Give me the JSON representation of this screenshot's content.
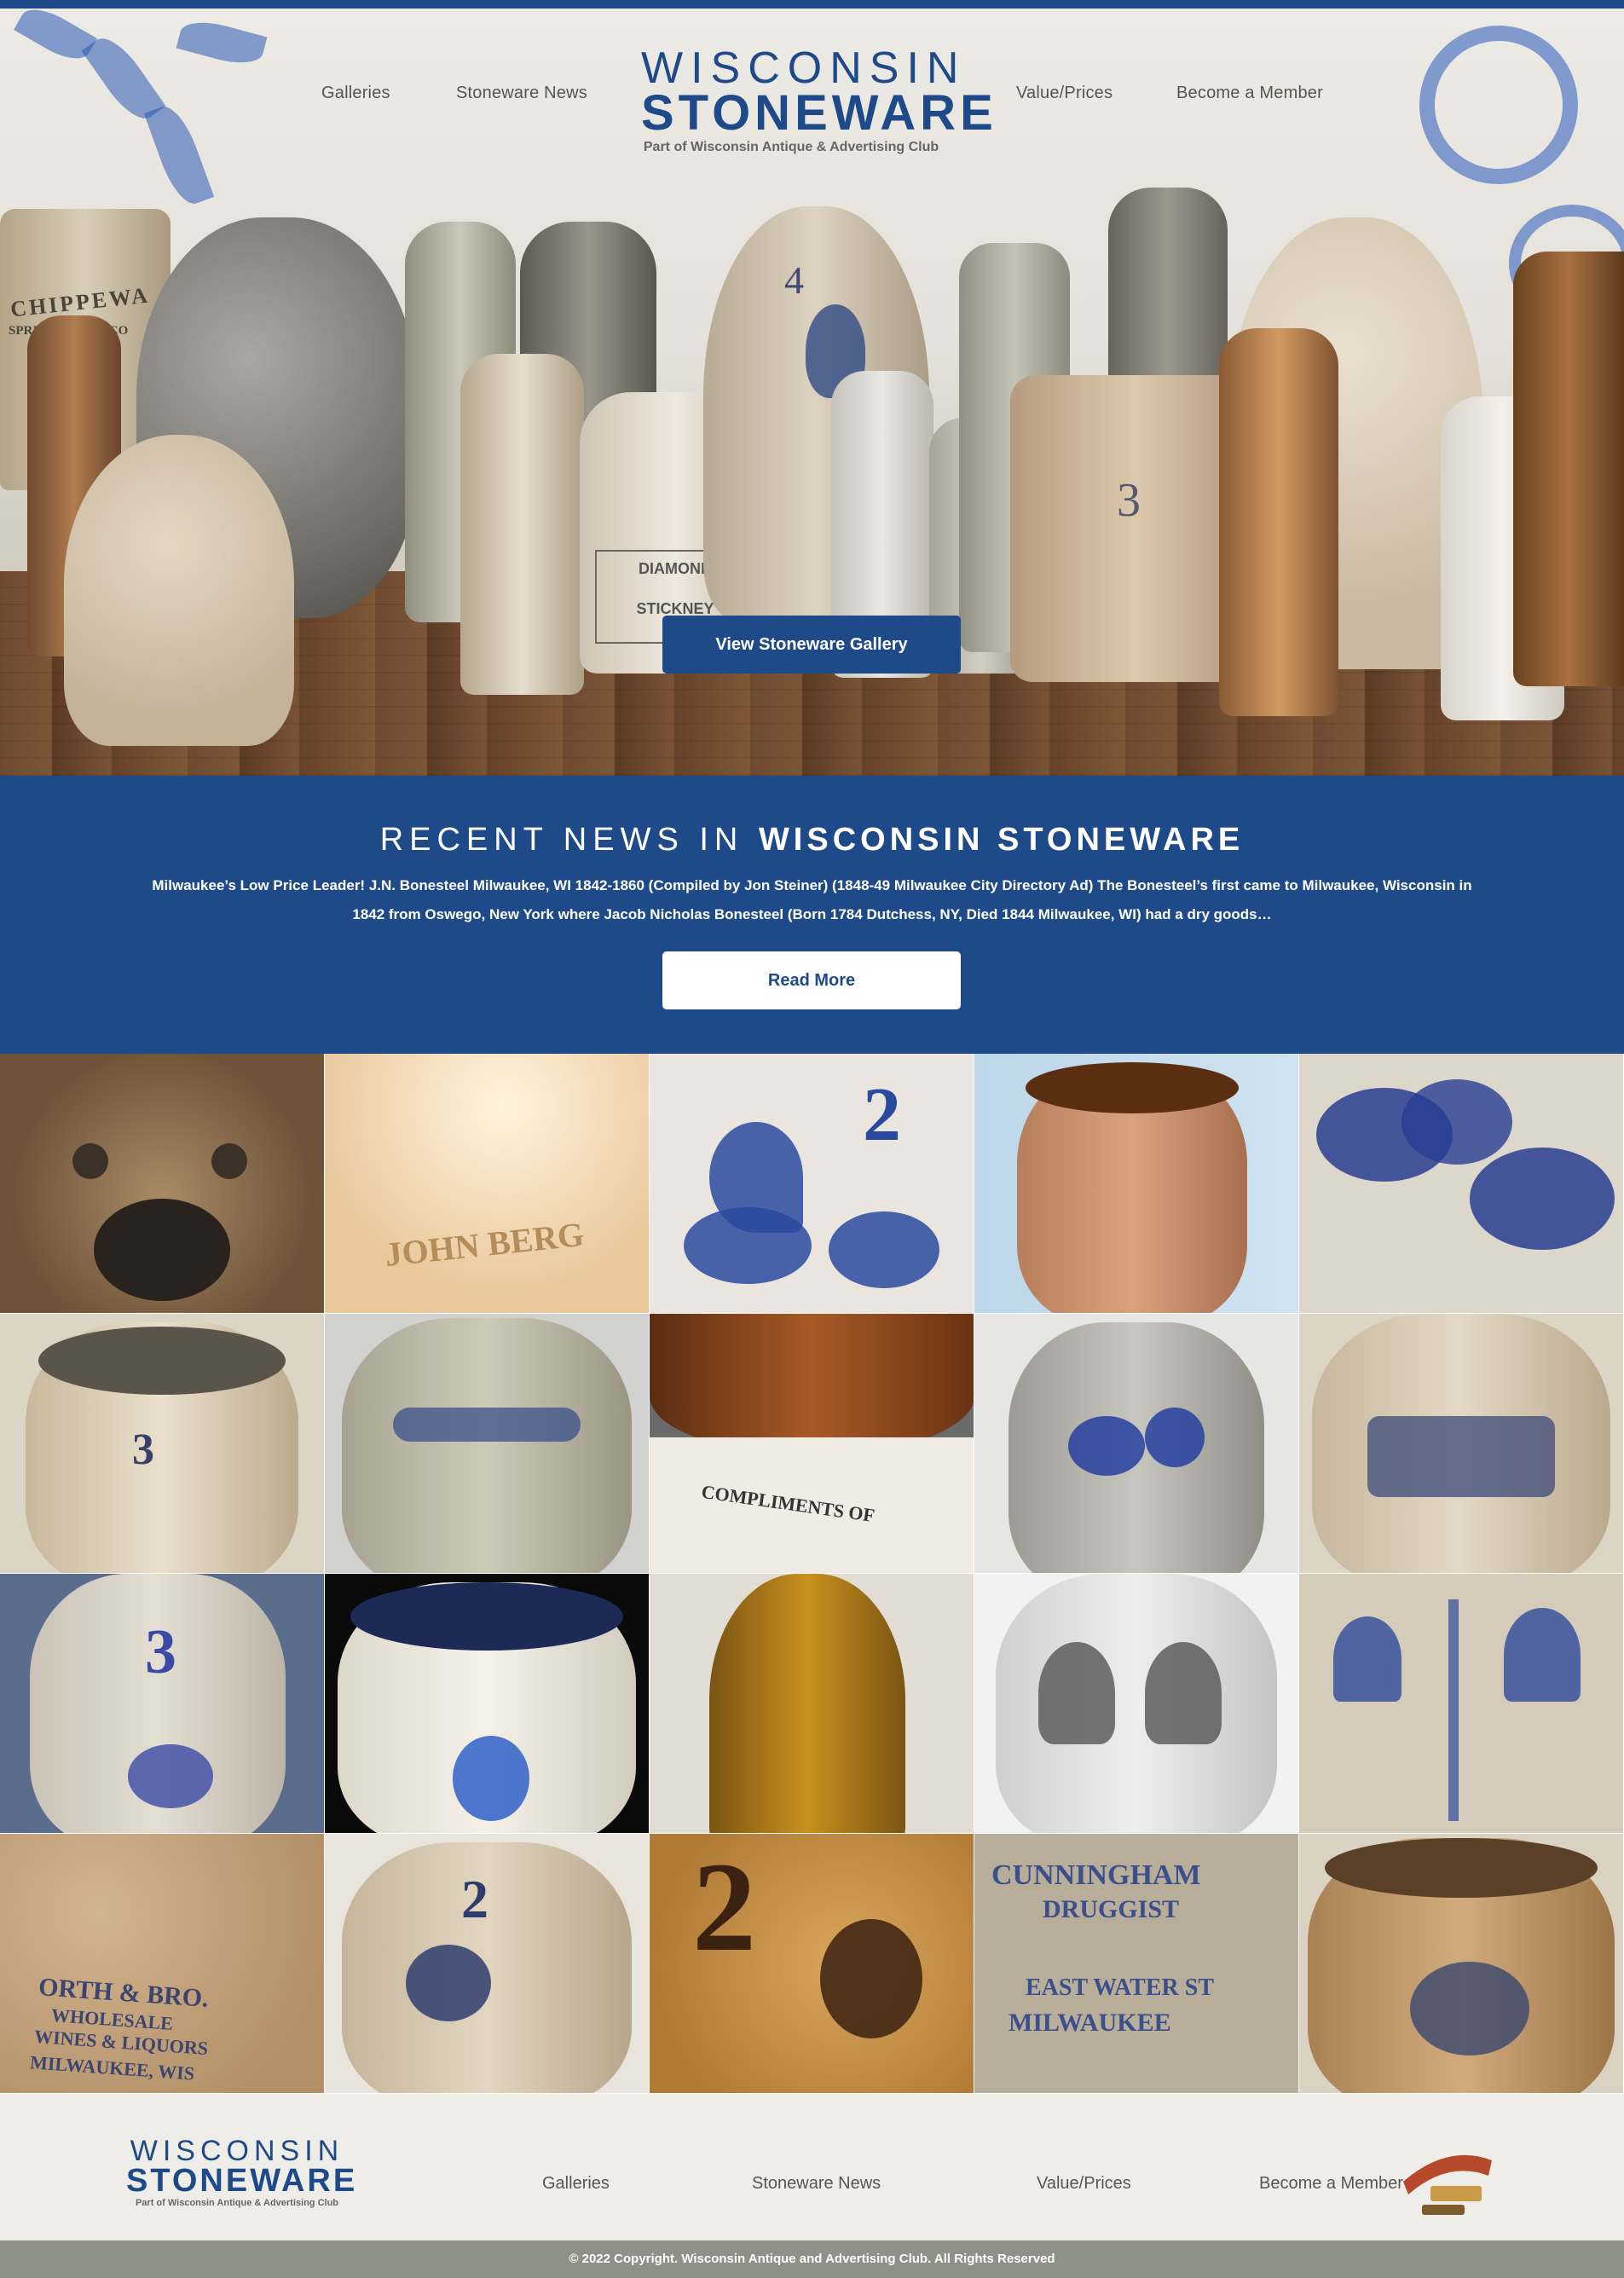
{
  "nav": {
    "items": [
      "Galleries",
      "Stoneware News",
      "Value/Prices",
      "Become a Member"
    ]
  },
  "logo": {
    "line1": "WISCONSIN",
    "line2": "STONEWARE",
    "tagline": "Part of Wisconsin Antique & Advertising Club"
  },
  "hero": {
    "button_label": "View Stoneware Gallery",
    "pot_marks": {
      "chippewa": "CHIPPEWA",
      "chippewa2": "SPRING WATER CO",
      "diamond": "DIAMOND",
      "diamond2": "STICKNEY",
      "crock_number": "3",
      "jug_number": "4"
    }
  },
  "news": {
    "title_light": "RECENT NEWS IN",
    "title_bold": "WISCONSIN STONEWARE",
    "excerpt": "Milwaukee’s Low Price Leader! J.N. Bonesteel Milwaukee, WI 1842-1860 (Compiled by Jon Steiner) (1848-49 Milwaukee City Directory Ad) The Bonesteel’s first came to Milwaukee, Wisconsin in 1842 from Oswego, New York where Jacob Nicholas Bonesteel (Born 1784 Dutchess, NY, Died 1844 Milwaukee, WI) had a dry goods…",
    "button_label": "Read More"
  },
  "gallery": {
    "marks": {
      "john_berg": "JOHN BERG",
      "num2": "2",
      "num3": "3",
      "compliments": "COMPLIMENTS OF",
      "orth": "ORTH & BRO.",
      "wholesale": "WHOLESALE",
      "wines": "WINES & LIQUORS",
      "milwaukee": "MILWAUKEE, WIS",
      "cunningham": "CUNNINGHAM",
      "druggist": "DRUGGIST",
      "east_water": "EAST WATER ST",
      "milwaukee2": "MILWAUKEE"
    }
  },
  "footer": {
    "copyright": "© 2022 Copyright. Wisconsin Antique and Advertising Club. All Rights Reserved",
    "club_logo_text": "Wisconsin"
  },
  "colors": {
    "brand_blue": "#1f4a8a",
    "footer_bar": "#8e9185"
  }
}
